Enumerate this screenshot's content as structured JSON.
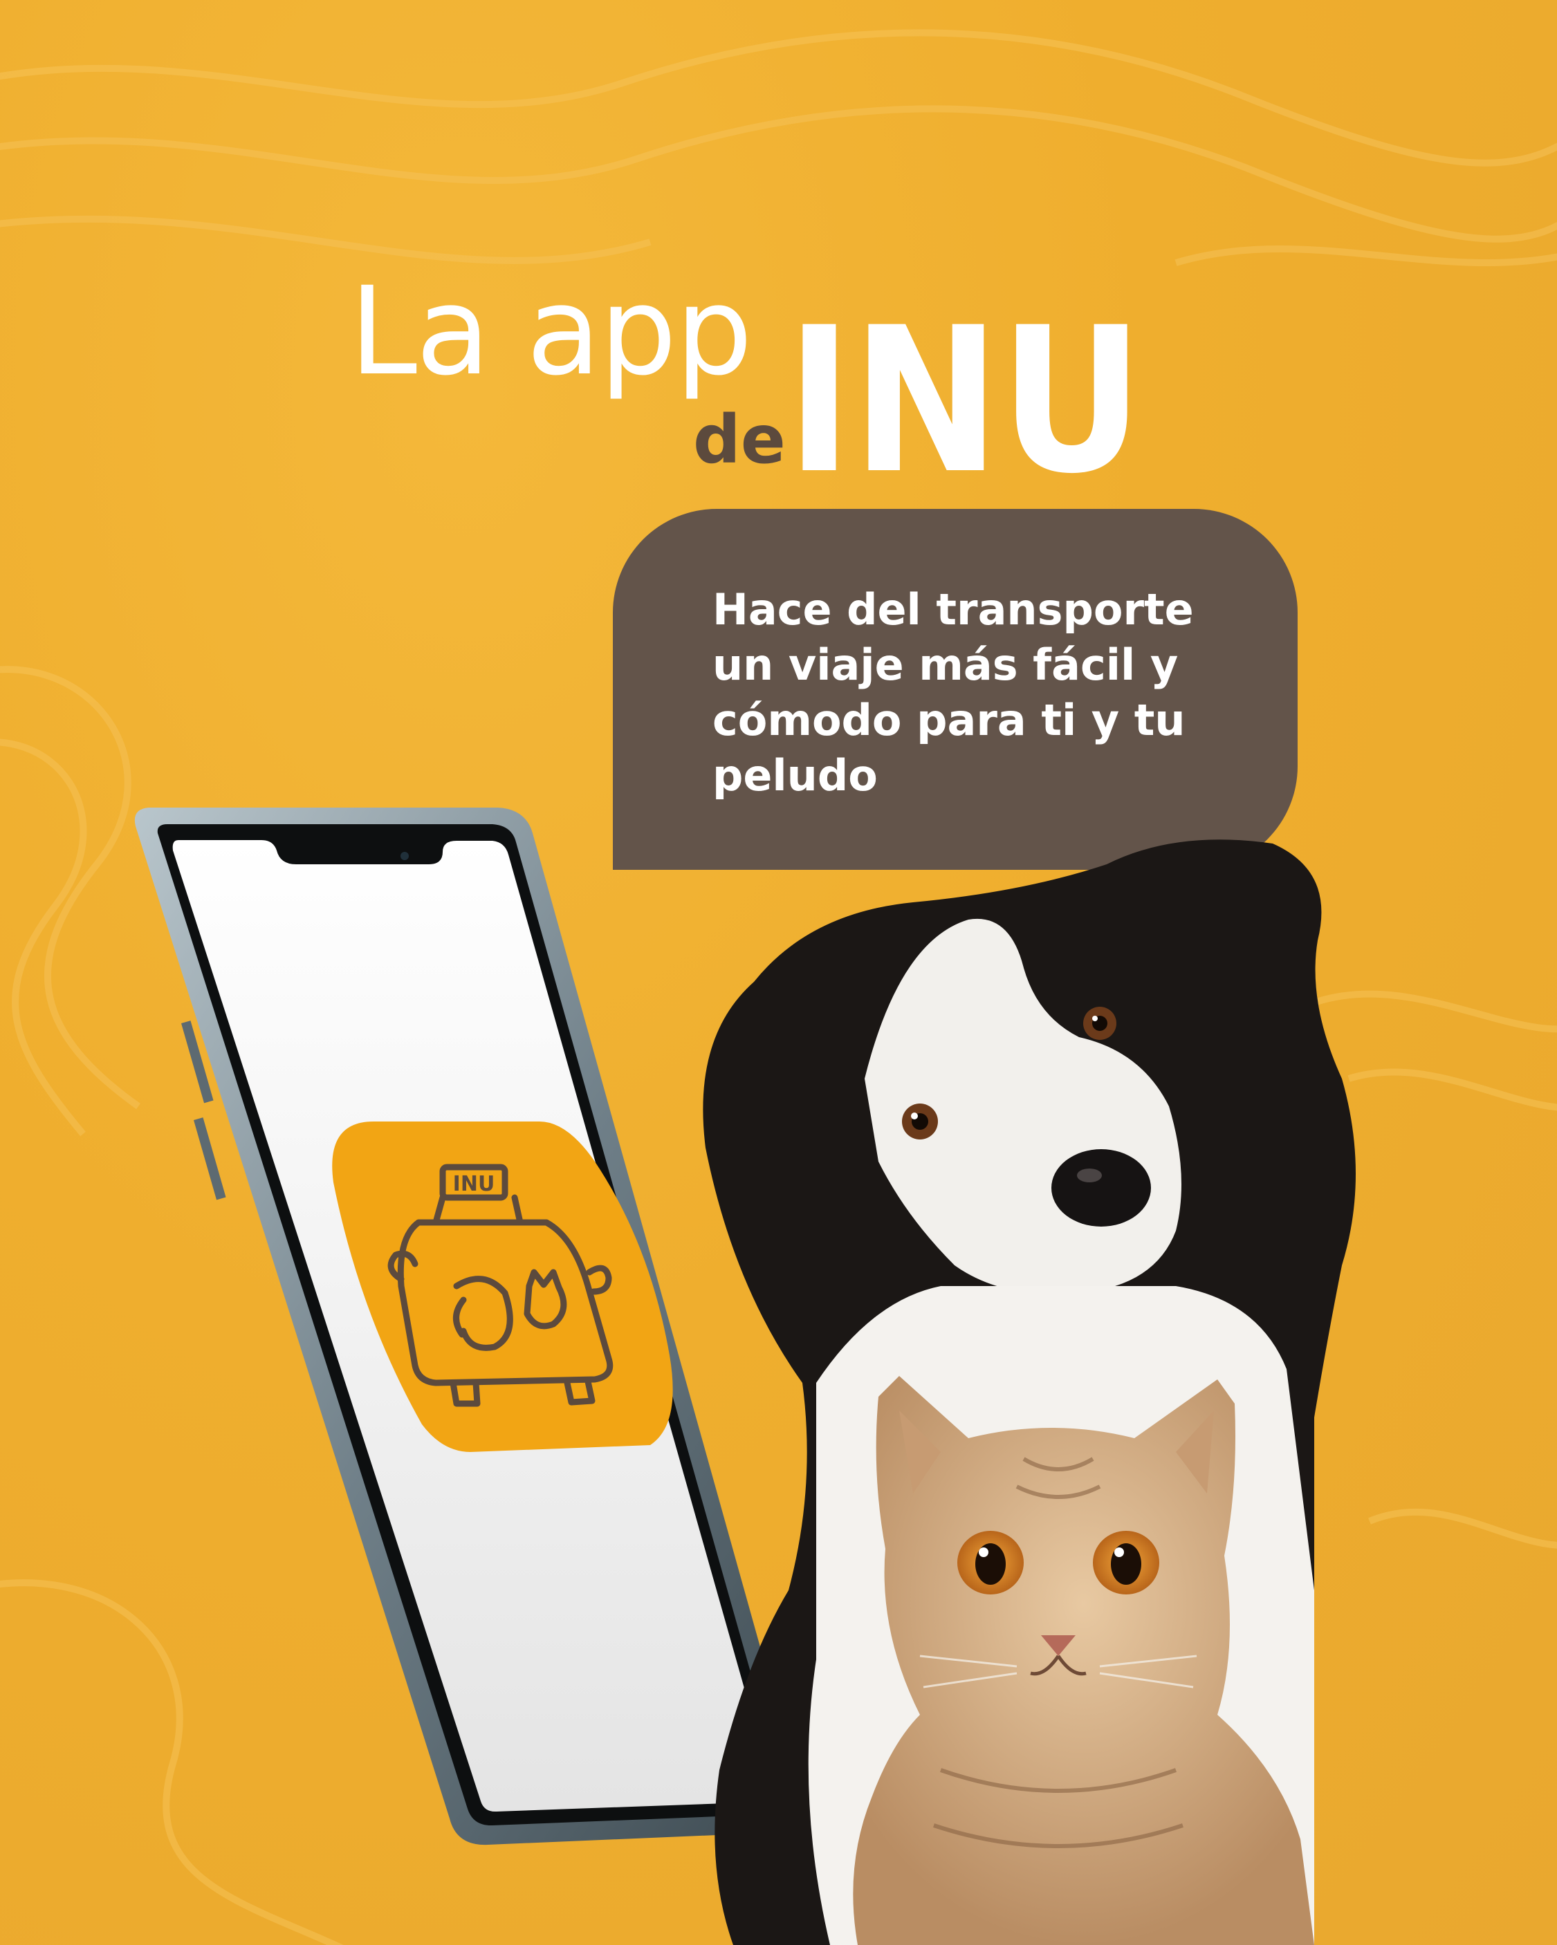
{
  "headline": {
    "line1": "La app",
    "line2": "de",
    "brand": "INU"
  },
  "bubble": {
    "lines": [
      "Hace del transporte",
      "un viaje más fácil y",
      "cómodo para ti y tu",
      "peludo"
    ]
  },
  "app_icon": {
    "sign_text": "INU"
  },
  "colors": {
    "background": "#efae2e",
    "bubble": "#63544a",
    "headline_text": "#ffffff",
    "de_text": "#5c4a3d",
    "app_icon": "#f2a514",
    "icon_lines": "#5c4a3d"
  }
}
